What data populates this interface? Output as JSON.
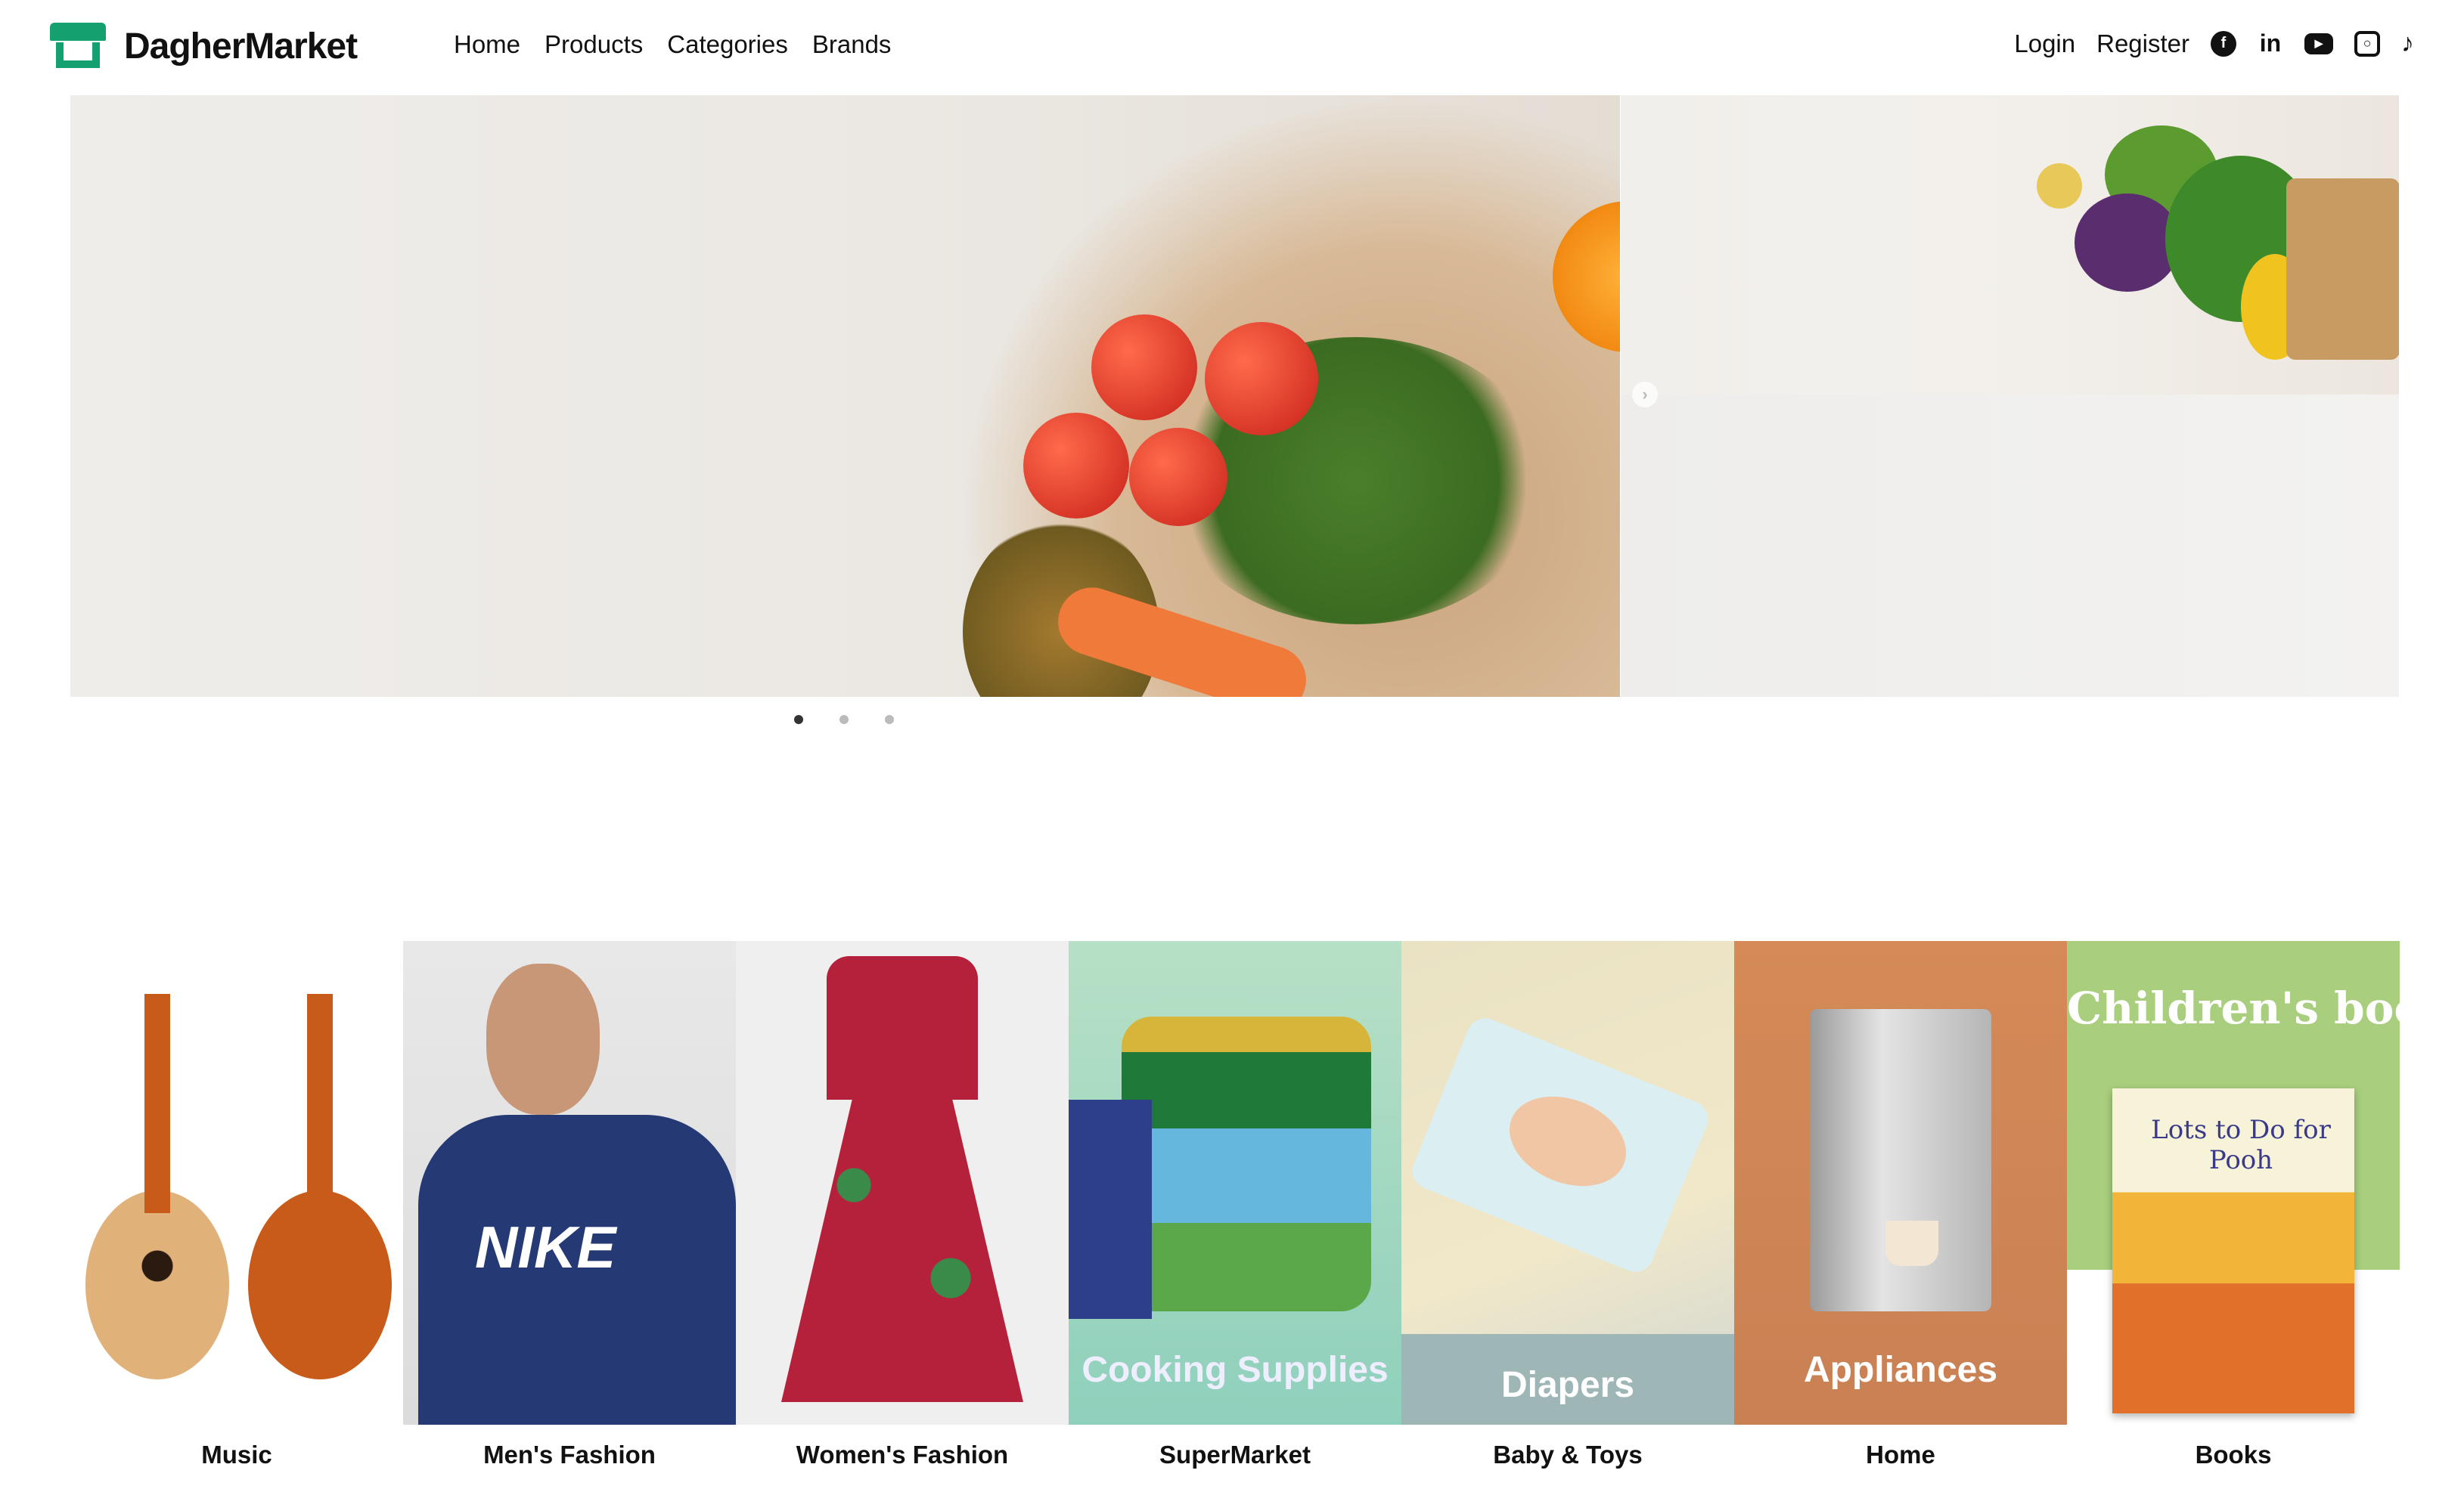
{
  "brand": {
    "name": "DagherMarket"
  },
  "menu": {
    "items": [
      "Home",
      "Products",
      "Categories",
      "Brands"
    ]
  },
  "auth": {
    "login": "Login",
    "register": "Register"
  },
  "social": [
    "facebook-icon",
    "linkedin-icon",
    "youtube-icon",
    "instagram-icon",
    "tiktok-icon"
  ],
  "colors": {
    "brand": "#14a06f"
  },
  "carousel": {
    "slides": 3,
    "active": 1
  },
  "categories": [
    {
      "label": "Music",
      "overlay": ""
    },
    {
      "label": "Men's Fashion",
      "overlay": ""
    },
    {
      "label": "Women's Fashion",
      "overlay": ""
    },
    {
      "label": "SuperMarket",
      "overlay": "Cooking Supplies"
    },
    {
      "label": "Baby & Toys",
      "overlay": "Diapers"
    },
    {
      "label": "Home",
      "overlay": "Appliances"
    },
    {
      "label": "Books",
      "overlay": "Children's books"
    }
  ]
}
